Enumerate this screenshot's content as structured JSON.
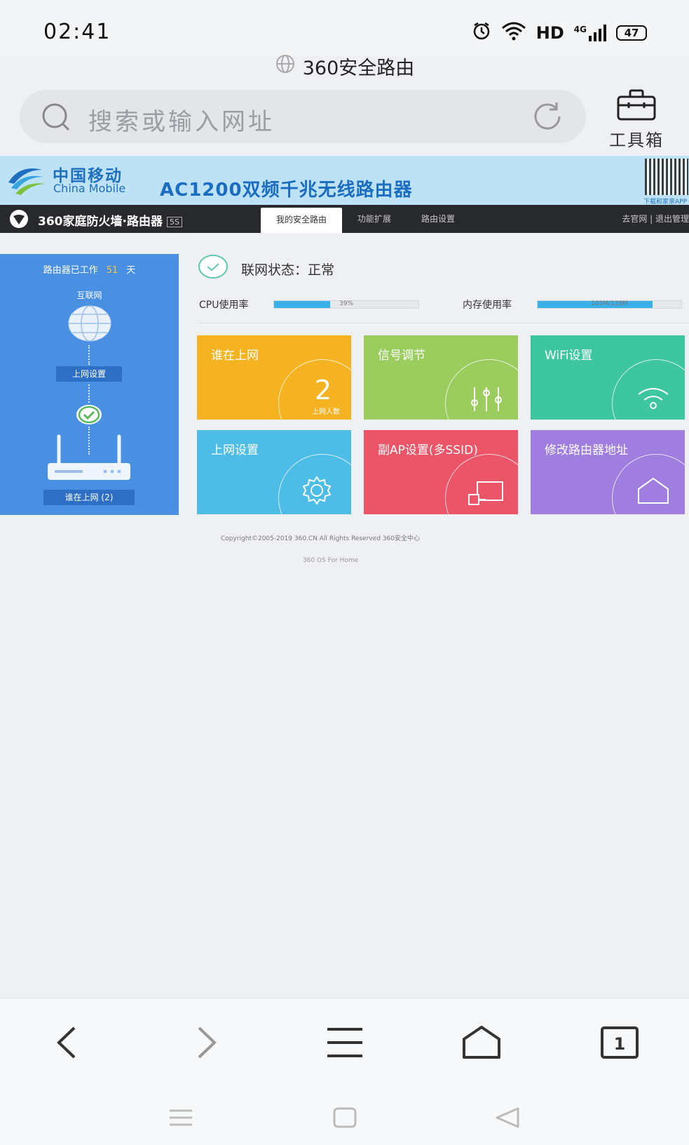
{
  "status_bar": {
    "time": "02:41",
    "network": "HD",
    "signal": "4G",
    "battery": "47"
  },
  "url_title": "360安全路由",
  "search": {
    "placeholder": "搜索或输入网址"
  },
  "toolbox_label": "工具箱",
  "banner": {
    "carrier_cn": "中国移动",
    "carrier_en": "China Mobile",
    "title": "AC1200双频千兆无线路由器",
    "qr_label": "下载和家亲APP"
  },
  "router_nav": {
    "brand": "360家庭防火墙·路由器",
    "badge": "5S",
    "tabs": [
      "我的安全路由",
      "功能扩展",
      "路由设置"
    ],
    "right_links": "去官网 | 退出管理"
  },
  "side_panel": {
    "uptime_prefix": "路由器已工作",
    "uptime_days": "51",
    "uptime_unit": "天",
    "internet_label": "互联网",
    "net_settings_btn": "上网设置",
    "online_btn": "谁在上网 (2)"
  },
  "status": {
    "text": "联网状态：正常",
    "cpu_label": "CPU使用率",
    "cpu_value": "39%",
    "cpu_fraction": 0.39,
    "mem_label": "内存使用率",
    "mem_value": "103M/128M",
    "mem_fraction": 0.8
  },
  "tiles": [
    {
      "title": "谁在上网",
      "color": "#f5b321",
      "number": "2",
      "number_label": "上网人数"
    },
    {
      "title": "信号调节",
      "color": "#9acd5e"
    },
    {
      "title": "WiFi设置",
      "color": "#3ec6a1"
    },
    {
      "title": "上网设置",
      "color": "#4dbde8"
    },
    {
      "title": "副AP设置(多SSID)",
      "color": "#ec5468"
    },
    {
      "title": "修改路由器地址",
      "color": "#a07ee0"
    }
  ],
  "footer": {
    "copyright": "Copyright©2005-2019 360.CN All Rights Reserved 360安全中心",
    "os": "360 OS For Home"
  },
  "bottom_nav": {
    "tabs_count": "1"
  },
  "icons": [
    "alarm-icon",
    "wifi-icon",
    "globe-icon",
    "search-icon",
    "refresh-icon",
    "toolbox-icon",
    "china-mobile-logo",
    "360-logo",
    "check-circle-icon",
    "router-icon",
    "sliders-icon",
    "wifi-signal-icon",
    "gear-icon",
    "ap-icon",
    "home-icon",
    "back-icon",
    "forward-icon",
    "menu-icon",
    "tabs-icon"
  ]
}
